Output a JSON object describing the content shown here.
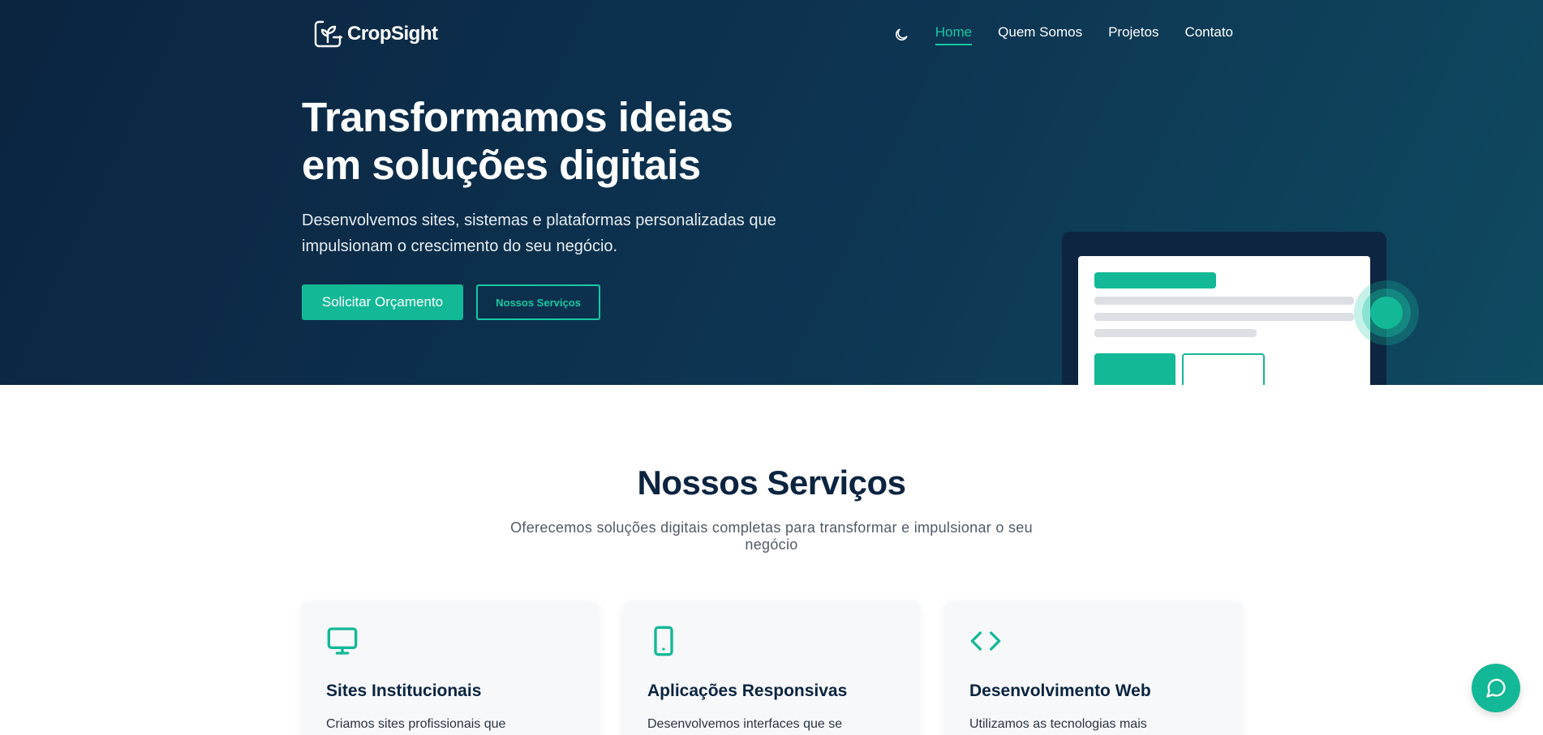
{
  "brand": {
    "name": "CropSight"
  },
  "nav": {
    "items": [
      {
        "label": "Home",
        "active": true
      },
      {
        "label": "Quem Somos",
        "active": false
      },
      {
        "label": "Projetos",
        "active": false
      },
      {
        "label": "Contato",
        "active": false
      }
    ],
    "theme_icon": "moon-icon"
  },
  "hero": {
    "title_line1": "Transformamos ideias",
    "title_line2": "em soluções digitais",
    "subtitle": "Desenvolvemos sites, sistemas e plataformas personalizadas que impulsionam o crescimento do seu negócio.",
    "primary_button": "Solicitar Orçamento",
    "secondary_button": "Nossos Serviços"
  },
  "services": {
    "title": "Nossos Serviços",
    "subtitle": "Oferecemos soluções digitais completas para transformar e impulsionar o seu negócio",
    "cards": [
      {
        "icon": "monitor-icon",
        "title": "Sites Institucionais",
        "text": "Criamos sites profissionais que"
      },
      {
        "icon": "smartphone-icon",
        "title": "Aplicações Responsivas",
        "text": "Desenvolvemos interfaces que se"
      },
      {
        "icon": "code-icon",
        "title": "Desenvolvimento Web",
        "text": "Utilizamos as tecnologias mais"
      }
    ]
  },
  "chat": {
    "icon": "chat-bubble-icon"
  },
  "colors": {
    "accent": "#13b896",
    "accent_light": "#19c9a4",
    "navy": "#0c2440",
    "hero_bg": "#0d3552"
  }
}
